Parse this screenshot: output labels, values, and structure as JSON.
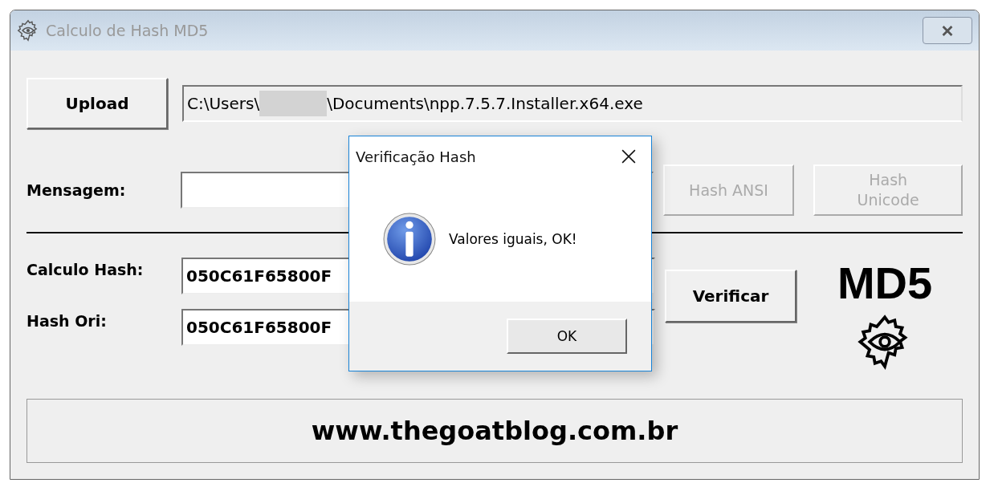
{
  "window": {
    "title": "Calculo de Hash MD5"
  },
  "upload_button": {
    "label": "Upload",
    "disabled": false
  },
  "file_path": {
    "parts": [
      "C:\\Users\\",
      "\\Documents\\npp.7.5.7.Installer.x64.exe"
    ]
  },
  "message": {
    "label": "Mensagem:"
  },
  "hash_buttons": [
    {
      "label": "Hash ANSI",
      "disabled": true
    },
    {
      "label": "Hash Unicode",
      "disabled": true
    }
  ],
  "hash_fields": [
    {
      "label": "Calculo Hash:",
      "value": "050C61F65800F"
    },
    {
      "label": "Hash Ori:",
      "value": "050C61F65800F"
    }
  ],
  "verify_button": {
    "label": "Verificar",
    "disabled": false
  },
  "logo": {
    "text": "MD5"
  },
  "footer": {
    "text": "www.thegoatblog.com.br"
  },
  "dialog": {
    "title": "Verificação Hash",
    "message": "Valores iguais, OK!",
    "button": "OK"
  }
}
